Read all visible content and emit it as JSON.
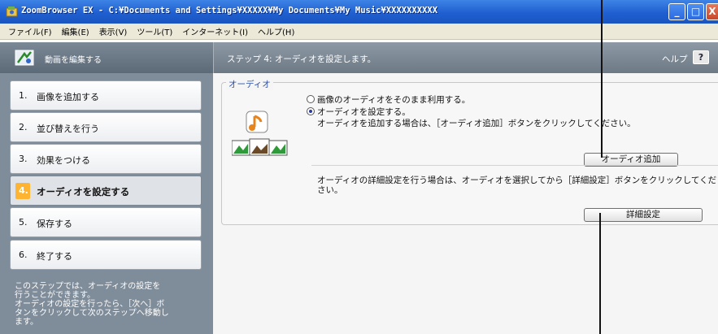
{
  "window": {
    "title": "ZoomBrowser EX - C:¥Documents and Settings¥XXXXX¥My Documents¥My Music¥XXXXXXXXXX",
    "controls": {
      "minimize": "_",
      "maximize": "□",
      "close": "X"
    }
  },
  "menu": [
    "ファイル(F)",
    "編集(E)",
    "表示(V)",
    "ツール(T)",
    "インターネット(I)",
    "ヘルプ(H)"
  ],
  "left_header": {
    "label": "動画を編集する"
  },
  "right_header": {
    "label": "ステップ 4: オーディオを設定します。",
    "help_label": "ヘルプ",
    "help_button": "?"
  },
  "steps": [
    {
      "num": "1.",
      "label": "画像を追加する",
      "active": false
    },
    {
      "num": "2.",
      "label": "並び替えを行う",
      "active": false
    },
    {
      "num": "3.",
      "label": "効果をつける",
      "active": false
    },
    {
      "num": "4.",
      "label": "オーディオを設定する",
      "active": true
    },
    {
      "num": "5.",
      "label": "保存する",
      "active": false
    },
    {
      "num": "6.",
      "label": "終了する",
      "active": false
    }
  ],
  "hint_lines": [
    "このステップでは、オーディオの設定を",
    "行うことができます。",
    "オーディオの設定を行ったら、［次へ］ボ",
    "タンをクリックして次のステップへ移動し",
    "ます。"
  ],
  "audio": {
    "group_label": "オーディオ",
    "option_keep": "画像のオーディオをそのまま利用する。",
    "option_set": "オーディオを設定する。",
    "selected": "set",
    "add_desc": "オーディオを追加する場合は、［オーディオ追加］ボタンをクリックしてください。",
    "add_button": "オーディオ追加",
    "detail_desc_1": "オーディオの詳細設定を行う場合は、オーディオを選択してから［詳細設定］ボタンをクリックしてくだ",
    "detail_desc_2": "さい。",
    "detail_button": "詳細設定"
  },
  "colors": {
    "titlebar": "#1f5fd0",
    "left_panel": "#7f8c99",
    "active_step_marker": "#ffb431",
    "group_label": "#2a4fb0"
  }
}
